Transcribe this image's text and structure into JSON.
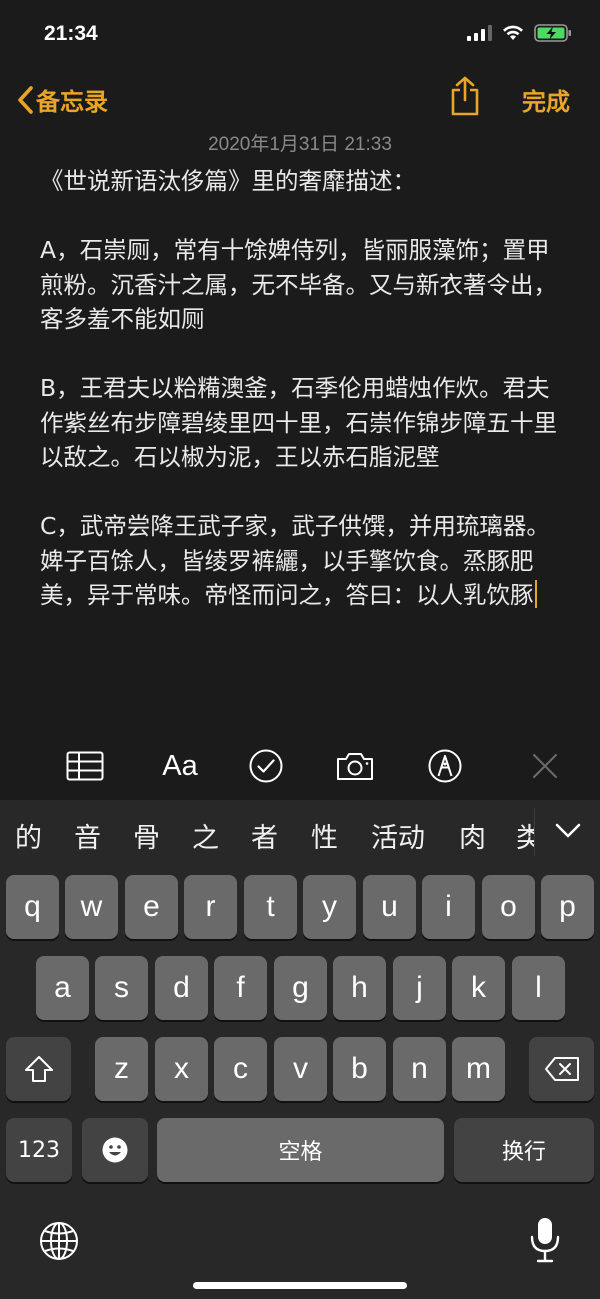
{
  "status_bar": {
    "time": "21:34"
  },
  "nav": {
    "back_label": "备忘录",
    "done_label": "完成"
  },
  "note": {
    "date": "2020年1月31日 21:33",
    "paragraphs": [
      "《世说新语汰侈篇》里的奢靡描述：",
      "A，石崇厕，常有十馀婢侍列，皆丽服藻饰；置甲煎粉。沉香汁之属，无不毕备。又与新衣著令出，客多羞不能如厕",
      "B，王君夫以粭糒澳釜，石季伦用蜡烛作炊。君夫作紫丝布步障碧绫里四十里，石崇作锦步障五十里以敌之。石以椒为泥，王以赤石脂泥壁",
      "C，武帝尝降王武子家，武子供馔，并用琉璃器。婢子百馀人，皆绫罗裤纚，以手擎饮食。烝豚肥美，异于常味。帝怪而问之，答曰：以人乳饮豚"
    ]
  },
  "toolbar": {
    "items": [
      "table-icon",
      "text-format-icon",
      "checklist-icon",
      "camera-icon",
      "markup-pen-icon",
      "close-icon"
    ],
    "text_format_label": "Aa"
  },
  "keyboard": {
    "candidates": [
      "的",
      "音",
      "骨",
      "之",
      "者",
      "性",
      "活动",
      "肉",
      "类"
    ],
    "row1": [
      "q",
      "w",
      "e",
      "r",
      "t",
      "y",
      "u",
      "i",
      "o",
      "p"
    ],
    "row2": [
      "a",
      "s",
      "d",
      "f",
      "g",
      "h",
      "j",
      "k",
      "l"
    ],
    "row3": [
      "z",
      "x",
      "c",
      "v",
      "b",
      "n",
      "m"
    ],
    "numbers_label": "123",
    "space_label": "空格",
    "return_label": "换行"
  },
  "colors": {
    "accent": "#e8a526",
    "background": "#1b1b1b",
    "key": "#6a6a6a",
    "func_key": "#434343",
    "date": "#8a8a8a"
  }
}
